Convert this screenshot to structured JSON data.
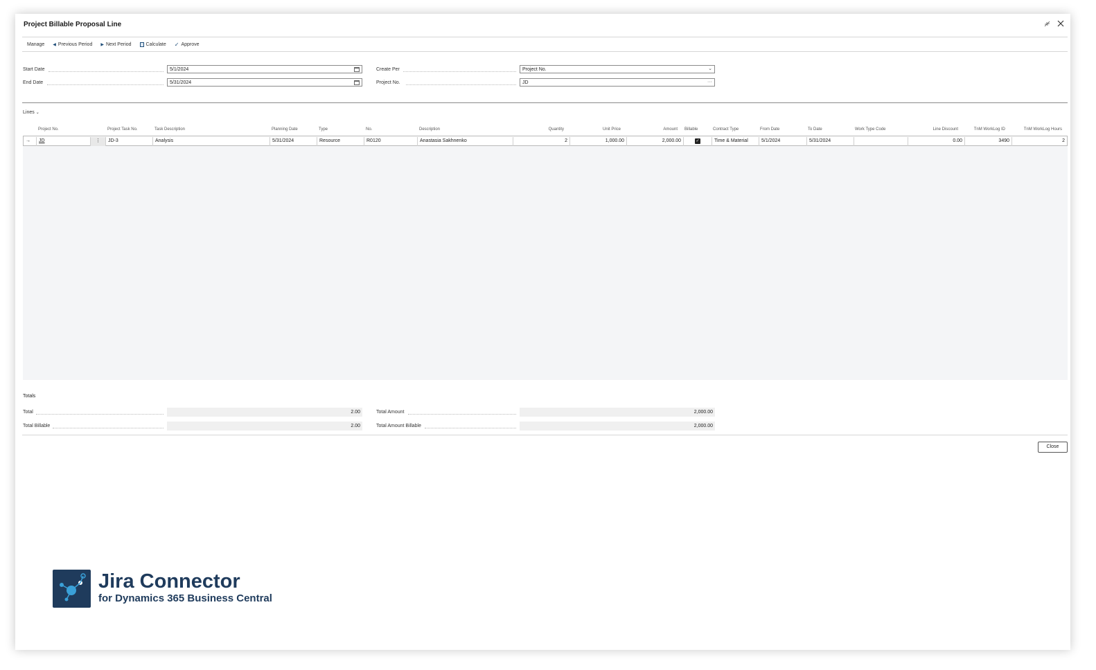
{
  "window": {
    "title": "Project Billable Proposal Line"
  },
  "actions": [
    {
      "label": "Manage"
    },
    {
      "label": "Previous Period"
    },
    {
      "label": "Next Period"
    },
    {
      "label": "Calculate"
    },
    {
      "label": "Approve"
    }
  ],
  "fields": {
    "start_date": {
      "label": "Start Date",
      "value": "5/1/2024"
    },
    "end_date": {
      "label": "End Date",
      "value": "5/31/2024"
    },
    "create_per": {
      "label": "Create Per",
      "value": "Project No."
    },
    "project_no": {
      "label": "Project No.",
      "value": "JD"
    }
  },
  "lines": {
    "label": "Lines",
    "columns": [
      "Project No.",
      "Project Task No.",
      "Task Description",
      "Planning Date",
      "Type",
      "No.",
      "Description",
      "Quantity",
      "Unit Price",
      "Amount",
      "Billable",
      "Contract Type",
      "From Date",
      "To Date",
      "Work Type Code",
      "Line Discount",
      "TnM WorkLog ID",
      "TnM WorkLog Hours"
    ],
    "rows": [
      {
        "project_no": "JD",
        "project_task_no": "JD-3",
        "task_description": "Analysis",
        "planning_date": "5/31/2024",
        "type": "Resource",
        "no": "R0120",
        "description": "Anastasia Sakhnenko",
        "quantity": "2",
        "unit_price": "1,000.00",
        "amount": "2,000.00",
        "billable": true,
        "contract_type": "Time & Material",
        "from_date": "5/1/2024",
        "to_date": "5/31/2024",
        "work_type_code": "",
        "line_discount": "0.00",
        "worklog_id": "3490",
        "worklog_hours": "2"
      }
    ]
  },
  "totals": {
    "label": "Totals",
    "total": {
      "label": "Total",
      "value": "2.00"
    },
    "total_billable": {
      "label": "Total Billable",
      "value": "2.00"
    },
    "total_amount": {
      "label": "Total Amount",
      "value": "2,000.00"
    },
    "total_amount_billable": {
      "label": "Total Amount Billable",
      "value": "2,000.00"
    }
  },
  "close_label": "Close",
  "brand": {
    "title": "Jira Connector",
    "subtitle": "for Dynamics 365 Business Central",
    "color": "#1f3b5c"
  }
}
